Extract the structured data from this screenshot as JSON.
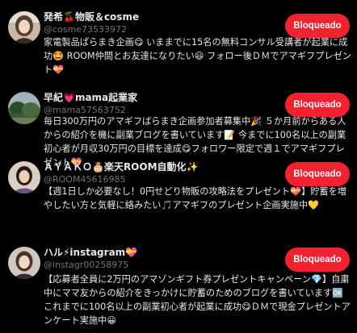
{
  "block_label": "Bloqueado",
  "users": [
    {
      "name": "発希🍒物販＆cosme",
      "handle": "@cosme73533972",
      "bio": "家電製品ぱらまき企画😋 いままでに15名の無料コンサル受講者が起業に成功🤩 ROOM仲間とお友達になりたい😃 フォロー後ＤＭでアマギフプレゼント💝",
      "avatar_icon": "woman-photo-avatar"
    },
    {
      "name": "早紀💗mama起業家",
      "handle": "@mama57563752",
      "bio": "毎日300万円のアマギフばらまき企画参加者募集中🎉 ５か月前からある人からの紹介を機に副業ブログを書いています📝 今までに100名以上の副業初心者が月収30万円の目標を達成😋フォロワー限定で週１でアマギフプレゼント💝",
      "avatar_icon": "landscape-photo-avatar"
    },
    {
      "name": "ＡＹＡＫＯ🎂楽天ROOM自動化✨",
      "handle": "@ROOM45616985",
      "bio": "【週1日しか必要なし！0円せどり物販の攻略法をプレゼント💝】貯蓄を増やしたい方と気軽に絡みたい🎵アマギフのプレゼント企画実施中💛",
      "avatar_icon": "woman-photo-avatar"
    },
    {
      "name": "ハル⚡instagram💝",
      "handle": "@instagr00258975",
      "bio": "【応募者全員に2万円のアマゾンギフト券プレゼントキャンペーン💎】自粛中にママ友からの紹介をきっかけに貯蓄のためのブログを書いています🆗 これまでに100名以上の副業初心者が起業に成功😋ＤＭで現金プレゼントアンケート実施中😀",
      "avatar_icon": "woman-photo-avatar"
    }
  ]
}
